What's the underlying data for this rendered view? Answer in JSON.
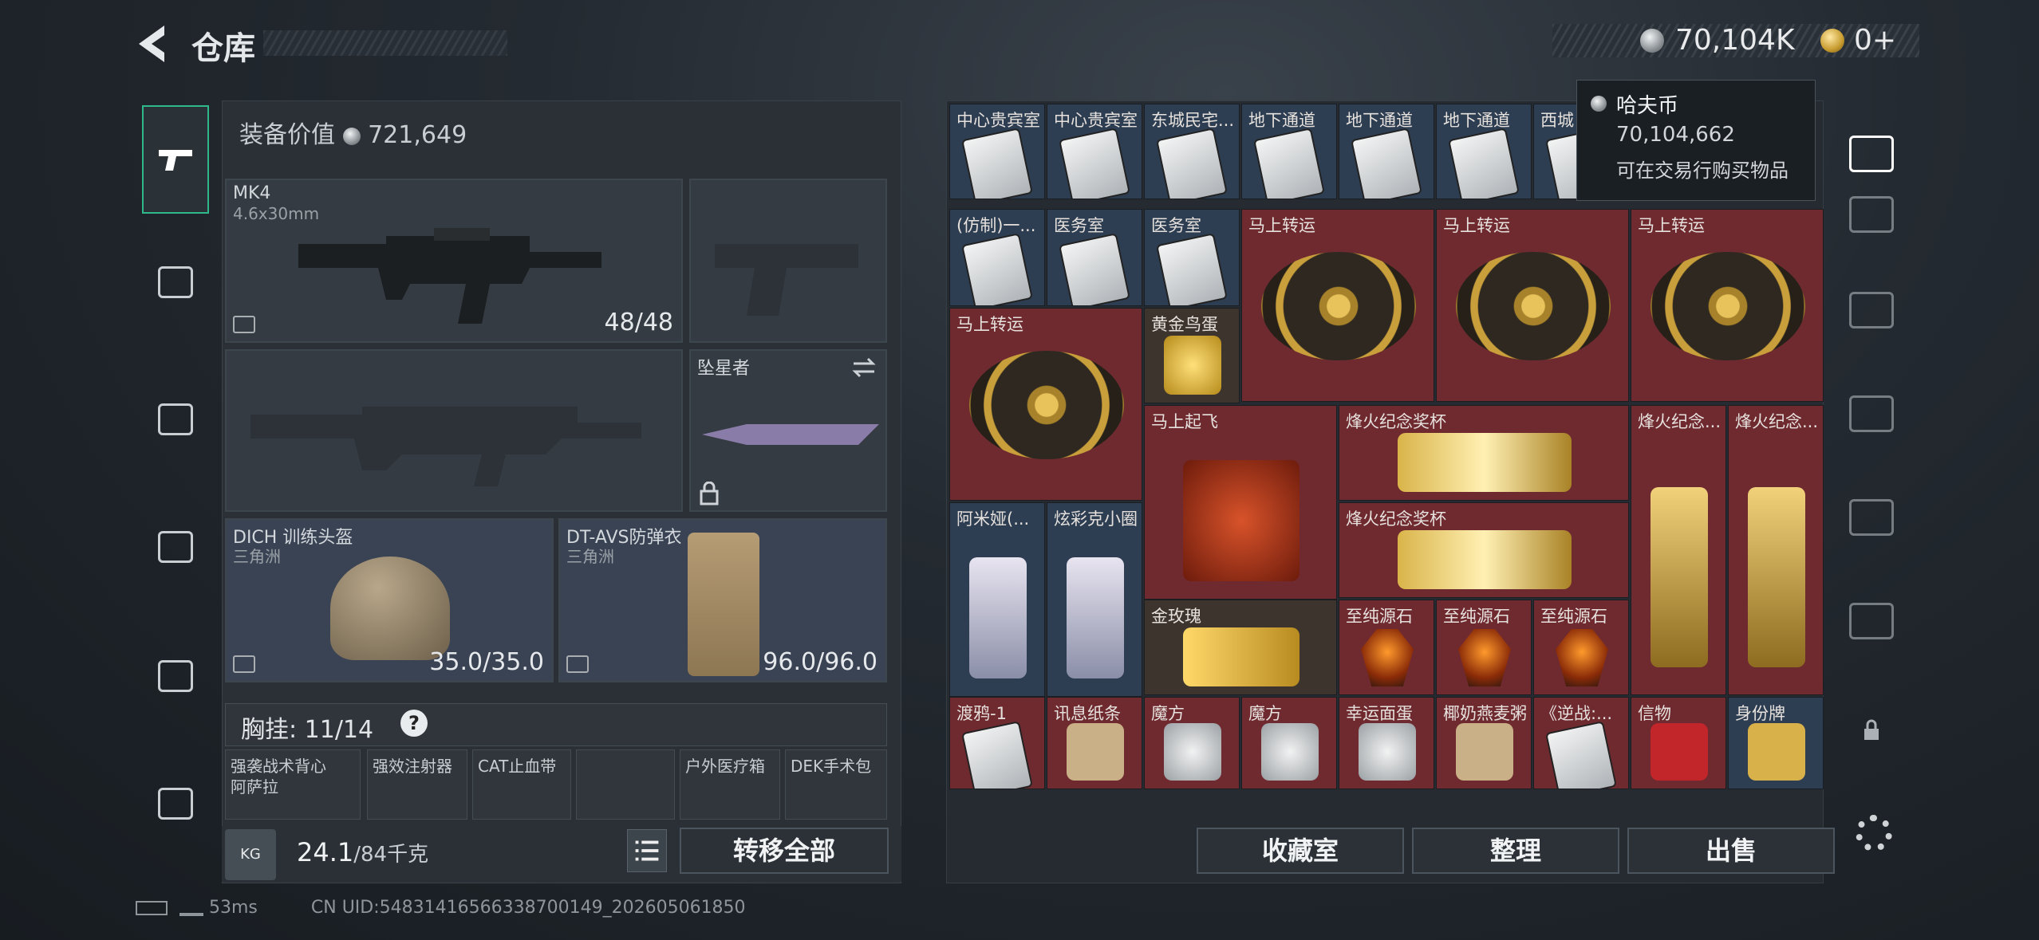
{
  "header": {
    "title": "仓库",
    "silver": "70,104K",
    "gold": "0+"
  },
  "left": {
    "equip_label": "装备价值",
    "equip_value": "721,649",
    "weapon": {
      "name": "MK4",
      "caliber": "4.6x30mm",
      "ammo": "48/48"
    },
    "melee": {
      "name": "坠星者"
    },
    "helmet": {
      "name": "DICH 训练头盔",
      "map": "三角洲",
      "dur": "35.0/35.0"
    },
    "armor": {
      "name": "DT-AVS防弹衣",
      "map": "三角洲",
      "dur": "96.0/96.0"
    },
    "rig_label": "胸挂: 11/14",
    "rig_help": "?",
    "rig_items": [
      "强袭战术背心",
      "阿萨拉",
      "强效注射器",
      "CAT止血带",
      "",
      "户外医疗箱",
      "DEK手术包"
    ],
    "weight": "24.1",
    "weight_max": "/84千克",
    "kg": "KG",
    "transfer": "转移全部"
  },
  "grid": {
    "row1": [
      "中心贵宾室",
      "中心贵宾室",
      "东城民宅...",
      "地下通道",
      "地下通道",
      "地下通道",
      "西城"
    ],
    "row2": [
      "(仿制)一...",
      "医务室",
      "医务室",
      "马上转运",
      "马上转运",
      "马上转运"
    ],
    "row3": [
      "马上转运",
      "黄金鸟蛋"
    ],
    "row4": [
      "马上起飞",
      "烽火纪念奖杯",
      "烽火纪念...",
      "烽火纪念..."
    ],
    "row5": [
      "阿米娅(...",
      "炫彩克小圈",
      "烽火纪念奖杯"
    ],
    "row6": [
      "金玫瑰",
      "至纯源石",
      "至纯源石",
      "至纯源石"
    ],
    "row7": [
      "渡鸦-1",
      "讯息纸条",
      "魔方",
      "魔方",
      "幸运面蛋",
      "椰奶燕麦粥",
      "《逆战:...",
      "信物",
      "身份牌"
    ]
  },
  "tooltip": {
    "name": "哈夫币",
    "value": "70,104,662",
    "desc": "可在交易行购买物品"
  },
  "buttons": {
    "collect": "收藏室",
    "sort": "整理",
    "sell": "出售"
  },
  "status": {
    "ping": "53ms",
    "uid": "CN UID:5483141656633870014​9_202605061850"
  },
  "icons": [
    "back-icon",
    "silver-coin-icon",
    "gold-coin-icon",
    "pistol-icon",
    "vest-icon",
    "backpack-icon",
    "bag-icon",
    "case-icon",
    "toolbox-icon",
    "home-icon",
    "lock-icon",
    "gear-icon",
    "swap-icon",
    "list-icon"
  ],
  "colors": {
    "accent": "#2fb88a",
    "red_cell": "#6f2a30",
    "blue_cell": "#2e3e52"
  }
}
